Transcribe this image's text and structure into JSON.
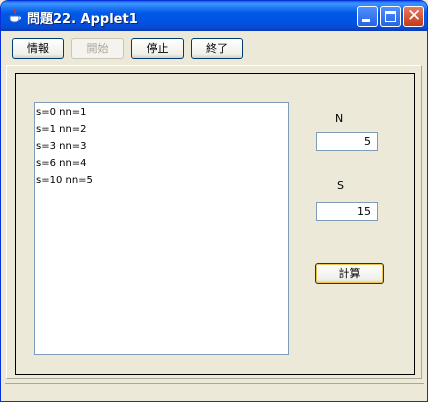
{
  "window": {
    "title": "問題22. Applet1",
    "icon": "java-cup-icon"
  },
  "toolbar": {
    "info_label": "情報",
    "start_label": "開始",
    "stop_label": "停止",
    "exit_label": "終了"
  },
  "output": {
    "lines": [
      "s=0 nn=1",
      "s=1 nn=2",
      "s=3 nn=3",
      "s=6 nn=4",
      "s=10 nn=5"
    ]
  },
  "form": {
    "n_label": "N",
    "n_value": "5",
    "s_label": "S",
    "s_value": "15",
    "calc_label": "計算"
  }
}
